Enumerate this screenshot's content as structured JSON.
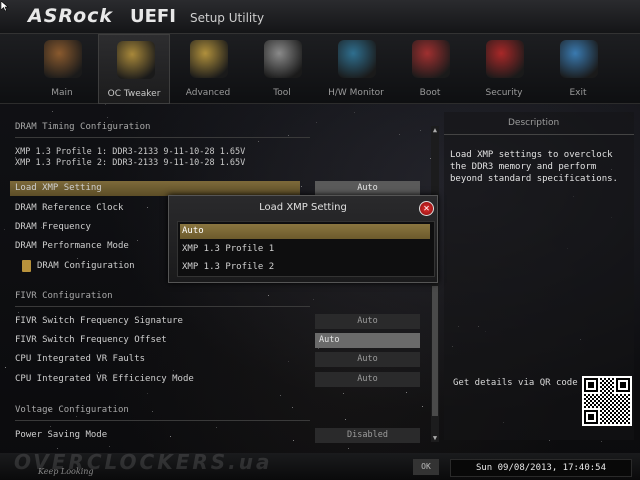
{
  "header": {
    "brand": "ASRock",
    "title": "UEFI",
    "subtitle": "Setup Utility"
  },
  "nav": {
    "tabs": [
      {
        "label": "Main",
        "icon": "main-icon",
        "color": "#8a5a2e"
      },
      {
        "label": "OC Tweaker",
        "icon": "rocket-icon",
        "color": "#a8883a"
      },
      {
        "label": "Advanced",
        "icon": "star-icon",
        "color": "#b0903c"
      },
      {
        "label": "Tool",
        "icon": "toolbox-icon",
        "color": "#8a8a8a"
      },
      {
        "label": "H/W Monitor",
        "icon": "monitor-gauge-icon",
        "color": "#2f6f8f"
      },
      {
        "label": "Boot",
        "icon": "boot-icon",
        "color": "#a03030"
      },
      {
        "label": "Security",
        "icon": "shield-icon",
        "color": "#a82828"
      },
      {
        "label": "Exit",
        "icon": "exit-icon",
        "color": "#3a7ab0"
      }
    ],
    "active": "OC Tweaker"
  },
  "main": {
    "section_dram": "DRAM Timing Configuration",
    "xmp_info_1": "XMP 1.3 Profile 1: DDR3-2133 9-11-10-28 1.65V",
    "xmp_info_2": "XMP 1.3 Profile 2: DDR3-2133 9-11-10-28 1.65V",
    "rows": [
      {
        "label": "Load XMP Setting",
        "value": "Auto"
      },
      {
        "label": "DRAM Reference Clock",
        "value": ""
      },
      {
        "label": "DRAM Frequency",
        "value": ""
      },
      {
        "label": "DRAM Performance Mode",
        "value": ""
      },
      {
        "label": "DRAM Configuration",
        "value": ""
      }
    ],
    "section_fivr": "FIVR Configuration",
    "fivr_rows": [
      {
        "label": "FIVR Switch Frequency Signature",
        "value": "Auto"
      },
      {
        "label": "FIVR Switch Frequency Offset",
        "value": "Auto"
      },
      {
        "label": "CPU Integrated VR Faults",
        "value": "Auto"
      },
      {
        "label": "CPU Integrated VR Efficiency Mode",
        "value": "Auto"
      }
    ],
    "section_voltage": "Voltage Configuration",
    "voltage_rows": [
      {
        "label": "Power Saving Mode",
        "value": "Disabled"
      }
    ]
  },
  "description": {
    "title": "Description",
    "text": "Load XMP settings to overclock the DDR3 memory and perform beyond standard specifications.",
    "qr_label": "Get details via QR code"
  },
  "popup": {
    "title": "Load XMP Setting",
    "options": [
      "Auto",
      "XMP 1.3 Profile 1",
      "XMP 1.3 Profile 2"
    ],
    "selected": "Auto"
  },
  "footer": {
    "watermark": "OVERCLOCKERS.ua",
    "signature": "Keep Looking",
    "ok": "OK",
    "datetime": "Sun 09/08/2013, 17:40:54"
  }
}
